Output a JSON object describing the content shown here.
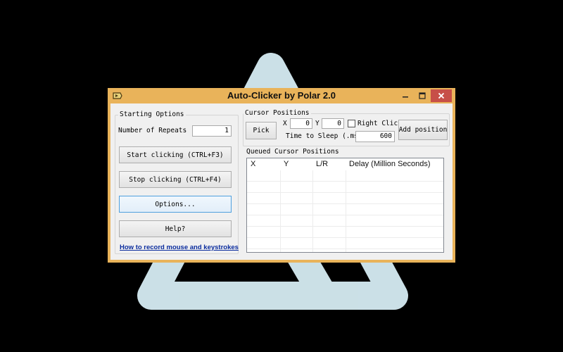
{
  "window": {
    "title": "Auto-Clicker by Polar 2.0",
    "controls": {
      "minimize": "minimize",
      "maximize": "maximize",
      "close": "close"
    }
  },
  "starting_options": {
    "group_label": "Starting Options",
    "repeats_label": "Number of Repeats",
    "repeats_value": "1",
    "start_button": "Start clicking (CTRL+F3)",
    "stop_button": "Stop clicking (CTRL+F4)",
    "options_button": "Options...",
    "help_button": "Help?",
    "record_link": "How to record mouse and keystrokes"
  },
  "cursor_positions": {
    "group_label": "Cursor Positions",
    "pick_button": "Pick",
    "x_label": "X",
    "x_value": "0",
    "y_label": "Y",
    "y_value": "0",
    "right_click_label": "Right Click",
    "right_click_checked": false,
    "sleep_label": "Time to Sleep (.ms)",
    "sleep_value": "600",
    "add_button": "Add position"
  },
  "queue": {
    "label": "Queued Cursor Positions",
    "columns": [
      "X",
      "Y",
      "L/R",
      "Delay (Million Seconds)"
    ],
    "rows": []
  },
  "colors": {
    "title_bar": "#e9b35a",
    "close_button": "#c74f48",
    "client_bg": "#f0f0f0",
    "wallpaper": "#000000",
    "watermark": "#d6ecf3"
  }
}
